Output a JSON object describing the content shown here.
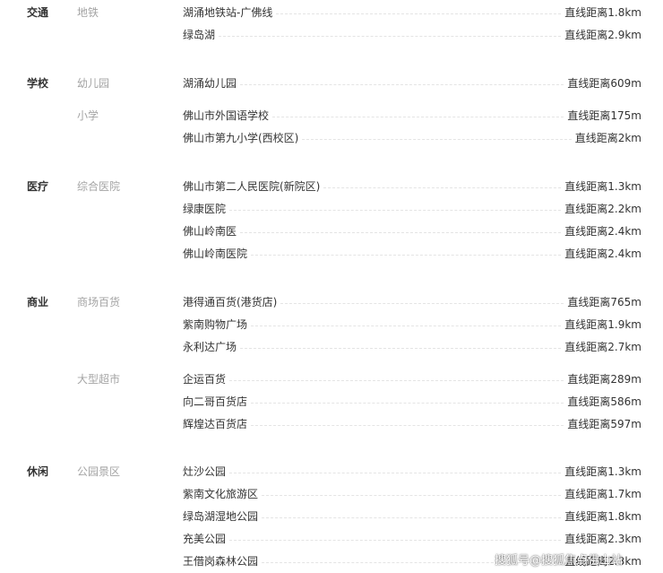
{
  "categories": [
    {
      "name": "交通",
      "subgroups": [
        {
          "name": "地铁",
          "items": [
            {
              "place": "湖涌地铁站-广佛线",
              "distance": "直线距离1.8km"
            },
            {
              "place": "绿岛湖",
              "distance": "直线距离2.9km"
            }
          ]
        }
      ]
    },
    {
      "name": "学校",
      "subgroups": [
        {
          "name": "幼儿园",
          "items": [
            {
              "place": "湖涌幼儿园",
              "distance": "直线距离609m"
            }
          ]
        },
        {
          "name": "小学",
          "items": [
            {
              "place": "佛山市外国语学校",
              "distance": "直线距离175m"
            },
            {
              "place": "佛山市第九小学(西校区)",
              "distance": "直线距离2km"
            }
          ]
        }
      ]
    },
    {
      "name": "医疗",
      "subgroups": [
        {
          "name": "综合医院",
          "items": [
            {
              "place": "佛山市第二人民医院(新院区)",
              "distance": "直线距离1.3km"
            },
            {
              "place": "绿康医院",
              "distance": "直线距离2.2km"
            },
            {
              "place": "佛山岭南医",
              "distance": "直线距离2.4km"
            },
            {
              "place": "佛山岭南医院",
              "distance": "直线距离2.4km"
            }
          ]
        }
      ]
    },
    {
      "name": "商业",
      "subgroups": [
        {
          "name": "商场百货",
          "items": [
            {
              "place": "港得通百货(港货店)",
              "distance": "直线距离765m"
            },
            {
              "place": "紫南购物广场",
              "distance": "直线距离1.9km"
            },
            {
              "place": "永利达广场",
              "distance": "直线距离2.7km"
            }
          ]
        },
        {
          "name": "大型超市",
          "items": [
            {
              "place": "企运百货",
              "distance": "直线距离289m"
            },
            {
              "place": "向二哥百货店",
              "distance": "直线距离586m"
            },
            {
              "place": "辉煌达百货店",
              "distance": "直线距离597m"
            }
          ]
        }
      ]
    },
    {
      "name": "休闲",
      "subgroups": [
        {
          "name": "公园景区",
          "items": [
            {
              "place": "灶沙公园",
              "distance": "直线距离1.3km"
            },
            {
              "place": "紫南文化旅游区",
              "distance": "直线距离1.7km"
            },
            {
              "place": "绿岛湖湿地公园",
              "distance": "直线距离1.8km"
            },
            {
              "place": "充美公园",
              "distance": "直线距离2.3km"
            },
            {
              "place": "王借岗森林公园",
              "distance": "直线距离2.3km"
            }
          ]
        }
      ]
    }
  ],
  "watermark": "搜狐号@搜狐焦点佛山站"
}
